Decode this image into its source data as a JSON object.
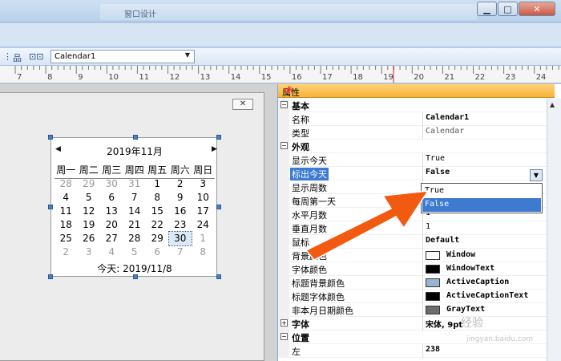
{
  "window": {
    "title": "窗口设计"
  },
  "toolbar": {
    "combo_value": "Calendar1"
  },
  "ruler": {
    "ticks": [
      "7",
      "8",
      "9",
      "10",
      "11",
      "12",
      "13",
      "14",
      "15",
      "16",
      "17",
      "18",
      "19",
      "20",
      "21",
      "22",
      "23",
      "24"
    ]
  },
  "calendar": {
    "header": "2019年11月",
    "weekdays": [
      "周一",
      "周二",
      "周三",
      "周四",
      "周五",
      "周六",
      "周日"
    ],
    "weeks": [
      [
        "28",
        "29",
        "30",
        "31",
        "1",
        "2",
        "3"
      ],
      [
        "4",
        "5",
        "6",
        "7",
        "8",
        "9",
        "10"
      ],
      [
        "11",
        "12",
        "13",
        "14",
        "15",
        "16",
        "17"
      ],
      [
        "18",
        "19",
        "20",
        "21",
        "22",
        "23",
        "24"
      ],
      [
        "25",
        "26",
        "27",
        "28",
        "29",
        "30",
        "1"
      ],
      [
        "2",
        "3",
        "4",
        "5",
        "6",
        "7",
        "8"
      ]
    ],
    "today": "今天: 2019/11/8"
  },
  "properties": {
    "title": "属性",
    "rows": [
      {
        "type": "category",
        "name": "基本",
        "toggle": "−"
      },
      {
        "type": "prop",
        "name": "名称",
        "value": "Calendar1"
      },
      {
        "type": "prop",
        "name": "类型",
        "value": "Calendar",
        "style": "grey"
      },
      {
        "type": "category",
        "name": "外观",
        "toggle": "−"
      },
      {
        "type": "prop",
        "name": "显示今天",
        "value": "True",
        "style": "normal"
      },
      {
        "type": "prop",
        "name": "标出今天",
        "value": "False",
        "selected": true
      },
      {
        "type": "prop",
        "name": "显示周数",
        "value": ""
      },
      {
        "type": "prop",
        "name": "每周第一天",
        "value": ""
      },
      {
        "type": "prop",
        "name": "水平月数",
        "value": "1",
        "style": "normal"
      },
      {
        "type": "prop",
        "name": "垂直月数",
        "value": "1",
        "style": "normal"
      },
      {
        "type": "prop",
        "name": "鼠标",
        "value": "Default"
      },
      {
        "type": "color",
        "name": "背景颜色",
        "value": "Window",
        "color": "#ffffff"
      },
      {
        "type": "color",
        "name": "字体颜色",
        "value": "WindowText",
        "color": "#000000"
      },
      {
        "type": "color",
        "name": "标题背景颜色",
        "value": "ActiveCaption",
        "color": "#99b4d1"
      },
      {
        "type": "color",
        "name": "标题字体颜色",
        "value": "ActiveCaptionText",
        "color": "#000000"
      },
      {
        "type": "color",
        "name": "非本月日期颜色",
        "value": "GrayText",
        "color": "#6d6d6d"
      },
      {
        "type": "category",
        "name": "字体",
        "toggle": "+",
        "value": "宋体, 9pt",
        "plain": true
      },
      {
        "type": "category",
        "name": "位置",
        "toggle": "−"
      },
      {
        "type": "prop",
        "name": "左",
        "value": "238"
      }
    ],
    "dropdown": [
      "True",
      "False"
    ]
  },
  "watermark": {
    "text": "经验",
    "sub": "jingyan.baidu.com"
  },
  "colors": {
    "arrow": "#f25a12",
    "selection": "#3d7ad0",
    "panel_header": "#f7b338"
  }
}
